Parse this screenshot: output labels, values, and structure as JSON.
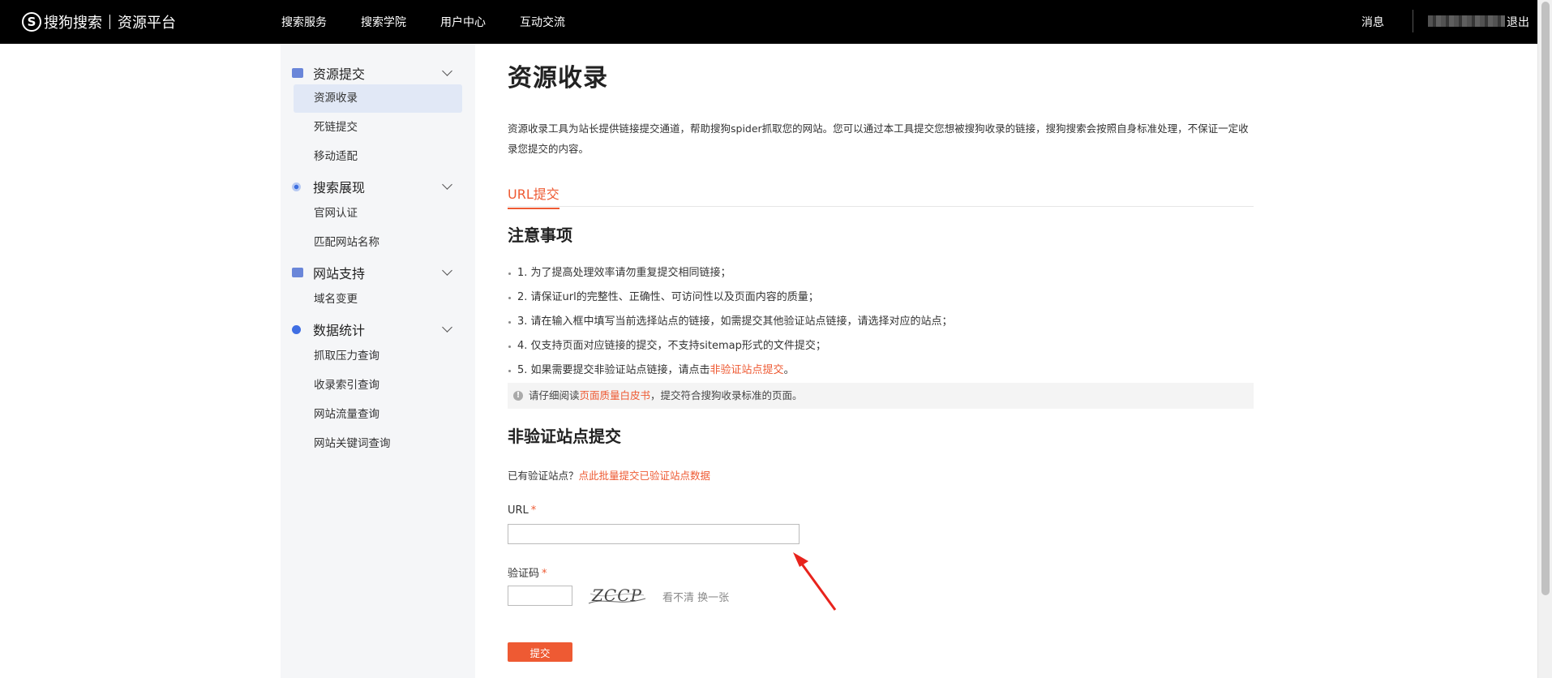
{
  "topbar": {
    "logo_letter": "S",
    "logo_brand": "搜狗搜索",
    "logo_sub": "资源平台",
    "nav": [
      "搜索服务",
      "搜索学院",
      "用户中心",
      "互动交流"
    ],
    "messages": "消息",
    "logout": "退出"
  },
  "sidebar": {
    "groups": [
      {
        "label": "资源提交",
        "icon": "box-icon",
        "items": [
          "资源收录",
          "死链提交",
          "移动适配"
        ]
      },
      {
        "label": "搜索展现",
        "icon": "eye-icon",
        "items": [
          "官网认证",
          "匹配网站名称"
        ]
      },
      {
        "label": "网站支持",
        "icon": "box-icon",
        "items": [
          "域名变更"
        ]
      },
      {
        "label": "数据统计",
        "icon": "dot-icon",
        "items": [
          "抓取压力查询",
          "收录索引查询",
          "网站流量查询",
          "网站关键词查询"
        ]
      }
    ],
    "active_item": "资源收录"
  },
  "main": {
    "title": "资源收录",
    "intro": "资源收录工具为站长提供链接提交通道，帮助搜狗spider抓取您的网站。您可以通过本工具提交您想被搜狗收录的链接，搜狗搜索会按照自身标准处理，不保证一定收录您提交的内容。",
    "tab": "URL提交",
    "notes_title": "注意事项",
    "notes": [
      "1. 为了提高处理效率请勿重复提交相同链接；",
      "2. 请保证url的完整性、正确性、可访问性以及页面内容的质量；",
      "3. 请在输入框中填写当前选择站点的链接，如需提交其他验证站点链接，请选择对应的站点；",
      "4. 仅支持页面对应链接的提交，不支持sitemap形式的文件提交；"
    ],
    "note5_prefix": "5. 如果需要提交非验证站点链接，请点击",
    "note5_link": "非验证站点提交",
    "note5_suffix": "。",
    "tip_prefix": "请仔细阅读",
    "tip_link": "页面质量白皮书",
    "tip_suffix": "，提交符合搜狗收录标准的页面。",
    "section_title": "非验证站点提交",
    "verified_prefix": "已有验证站点？",
    "verified_link": "点此批量提交已验证站点数据",
    "url_label": "URL",
    "captcha_label": "验证码",
    "required_mark": "*",
    "captcha_text": "ZCCP",
    "refresh_text": "看不清 换一张",
    "submit_label": "提交"
  },
  "colors": {
    "accent": "#ee5a33",
    "topbar_bg": "#000000",
    "sidebar_bg": "#f5f6f8",
    "active_item_bg": "#e1e8f6"
  }
}
